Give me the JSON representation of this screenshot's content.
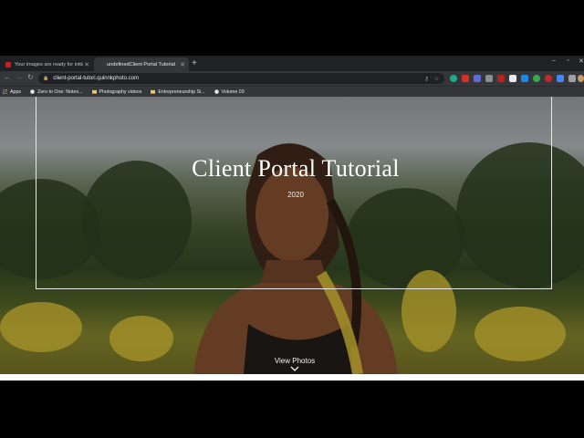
{
  "browser": {
    "tabs": [
      {
        "title": "Your images are ready for initial",
        "active": false,
        "favicon_color": "#c5221f"
      },
      {
        "title": "undefinedClient Portal Tutorial",
        "active": true,
        "favicon_color": ""
      }
    ],
    "new_tab_symbol": "+",
    "url": "client-portal-tutori.quinnkphoto.com",
    "bookmarks": [
      {
        "label": "Apps",
        "icon": "apps-grid-icon"
      },
      {
        "label": "Zero to One: Notes...",
        "icon": "globe-icon"
      },
      {
        "label": "Photography videos",
        "icon": "folder-icon"
      },
      {
        "label": "Entrepreneurship Si...",
        "icon": "folder-icon"
      },
      {
        "label": "Volume 03",
        "icon": "globe-icon"
      }
    ]
  },
  "hero": {
    "title": "Client Portal Tutorial",
    "year": "2020",
    "cta": "View Photos"
  }
}
